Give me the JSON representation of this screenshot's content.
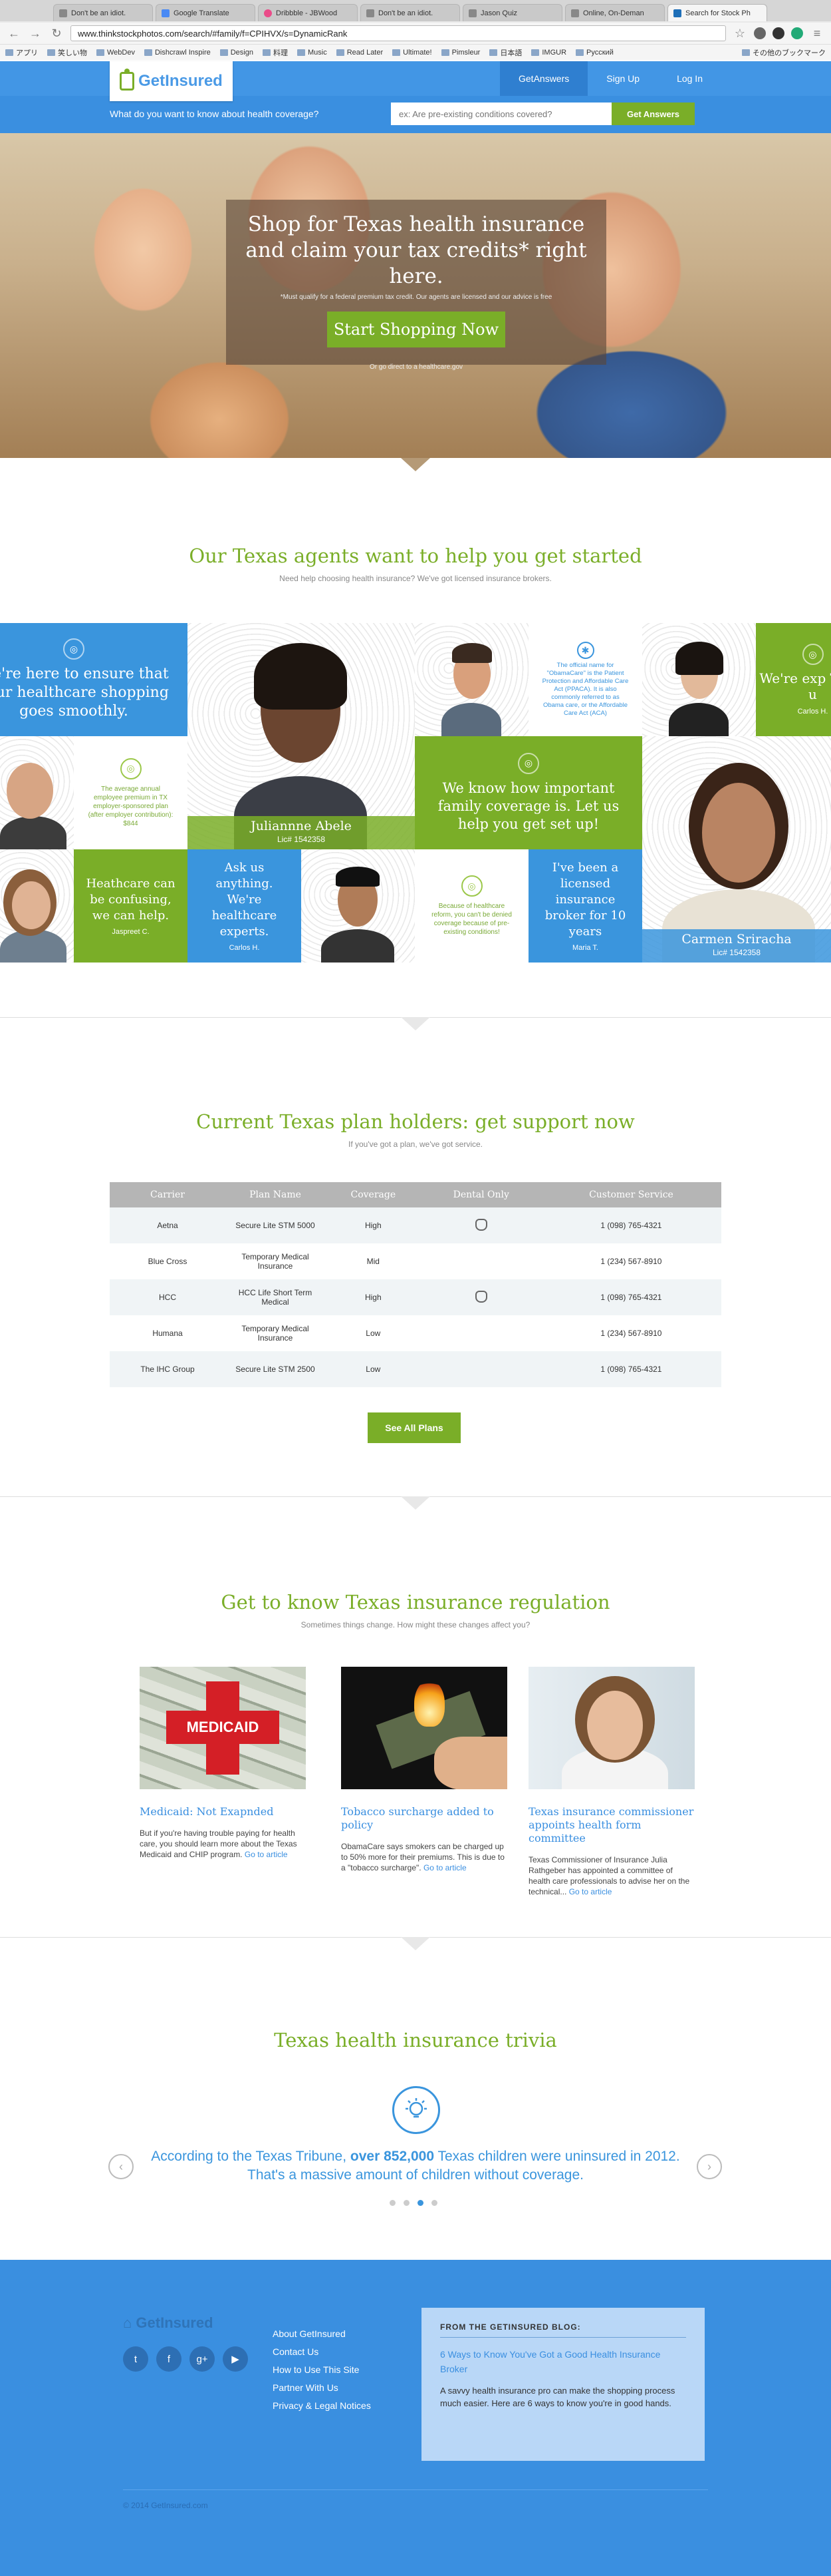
{
  "browser": {
    "tabs": [
      "Don't be an idiot.",
      "Google Translate",
      "Dribbble - JBWood",
      "Don't be an idiot.",
      "Jason Quiz",
      "Online, On-Deman",
      "Search for Stock Ph"
    ],
    "url": "www.thinkstockphotos.com/search/#family/f=CPIHVX/s=DynamicRank",
    "bookmarks": [
      "アプリ",
      "笑しい物",
      "WebDev",
      "Dishcrawl Inspire",
      "Design",
      "料理",
      "Music",
      "Read Later",
      "Ultimate!",
      "Pimsleur",
      "日本語",
      "IMGUR",
      "Русский",
      "その他のブックマーク"
    ]
  },
  "header": {
    "logo_text": "GetInsured",
    "nav": [
      "GetAnswers",
      "Sign Up",
      "Log In"
    ]
  },
  "search": {
    "question": "What do you want to know about health coverage?",
    "placeholder": "ex: Are pre-existing conditions covered?",
    "button": "Get Answers"
  },
  "hero": {
    "title": "Shop for Texas health insurance and claim your tax credits* right here.",
    "subtitle": "*Must qualify for a federal premium tax credit. Our agents are licensed and our advice is free",
    "button": "Start Shopping Now",
    "link": "Or go direct to a healthcare.gov"
  },
  "agents": {
    "title": "Our Texas agents want to help you get started",
    "subtitle": "Need help choosing health insurance? We've got licensed insurance brokers.",
    "tile_ensure": "We're here to ensure that your healthcare shopping goes smoothly.",
    "tile_premium": "The average annual employee premium in TX employer-sponsored plan (after employer contribution): $844",
    "tile_obamacare": "The official name for \"ObamaCare\" is the Patient Protection and Affordable Care Act (PPACA). It is also commonly referred to as Obama care, or the Affordable Care Act (ACA)",
    "tile_trust": "We're exp Trust u",
    "tile_trust_name": "Carlos H.",
    "tile_important": "We know how important family coverage is. Let us help you get set up!",
    "tile_confusing": "Heathcare can be confusing, we can help.",
    "tile_confusing_name": "Jaspreet C.",
    "tile_ask": "Ask us anything. We're healthcare experts.",
    "tile_ask_name": "Carlos H.",
    "tile_reform": "Because of healthcare reform, you can't be denied coverage because of pre-existing conditions!",
    "tile_broker": "I've been a licensed insurance broker for 10 years",
    "tile_broker_name": "Maria T.",
    "agent1_name": "Juliannne Abele",
    "agent1_lic": "Lic# 1542358",
    "agent2_name": "Carmen Sriracha",
    "agent2_lic": "Lic# 1542358"
  },
  "plans": {
    "title": "Current Texas plan holders: get support now",
    "subtitle": "If you've got a plan, we've got service.",
    "columns": [
      "Carrier",
      "Plan Name",
      "Coverage",
      "Dental Only",
      "Customer Service"
    ],
    "rows": [
      {
        "carrier": "Aetna",
        "plan": "Secure Lite STM 5000",
        "coverage": "High",
        "dental": true,
        "phone": "1 (098) 765-4321"
      },
      {
        "carrier": "Blue Cross",
        "plan": "Temporary Medical Insurance",
        "coverage": "Mid",
        "dental": false,
        "phone": "1 (234) 567-8910"
      },
      {
        "carrier": "HCC",
        "plan": "HCC Life Short Term Medical",
        "coverage": "High",
        "dental": true,
        "phone": "1 (098) 765-4321"
      },
      {
        "carrier": "Humana",
        "plan": "Temporary Medical Insurance",
        "coverage": "Low",
        "dental": false,
        "phone": "1 (234) 567-8910"
      },
      {
        "carrier": "The IHC Group",
        "plan": "Secure Lite STM 2500",
        "coverage": "Low",
        "dental": false,
        "phone": "1 (098) 765-4321"
      }
    ],
    "button": "See All Plans"
  },
  "regulation": {
    "title": "Get to know Texas insurance regulation",
    "subtitle": "Sometimes things change. How might these changes affect you?",
    "medicaid_label": "MEDICAID",
    "articles": [
      {
        "title": "Medicaid: Not Exapnded",
        "body": "But if you're having trouble paying for health care, you should learn more about the Texas Medicaid and CHIP program.",
        "more": "Go to article"
      },
      {
        "title": "Tobacco surcharge added to policy",
        "body": "ObamaCare says smokers can be charged up to 50% more for their premiums. This is due to a \"tobacco surcharge\".",
        "more": "Go to article"
      },
      {
        "title": "Texas insurance commissioner appoints health form committee",
        "body": "Texas Commissioner of Insurance Julia Rathgeber has appointed a committee of health care professionals to advise her on the technical...",
        "more": "Go to article"
      }
    ]
  },
  "trivia": {
    "title": "Texas health insurance trivia",
    "text_before": "According to the Texas Tribune, ",
    "text_bold": "over 852,000",
    "text_after": " Texas children were uninsured in 2012. That's a massive amount of children without coverage.",
    "active_slide": 3,
    "slide_count": 4
  },
  "footer": {
    "logo_text": "GetInsured",
    "social": [
      "twitter-icon",
      "facebook-icon",
      "google-plus-icon",
      "youtube-icon"
    ],
    "links": [
      "About GetInsured",
      "Contact Us",
      "How to Use This Site",
      "Partner With Us",
      "Privacy & Legal Notices"
    ],
    "blog_heading": "FROM THE GETINSURED BLOG:",
    "blog_link": "6 Ways to Know You've Got a Good Health Insurance Broker",
    "blog_body": "A savvy health insurance pro can make the shopping process much easier. Here are 6 ways to know you're in good hands.",
    "copyright": "© 2014 GetInsured.com"
  },
  "colors": {
    "brand_blue": "#4296e5",
    "brand_green": "#7aae28",
    "link_blue": "#3a8fe0"
  }
}
